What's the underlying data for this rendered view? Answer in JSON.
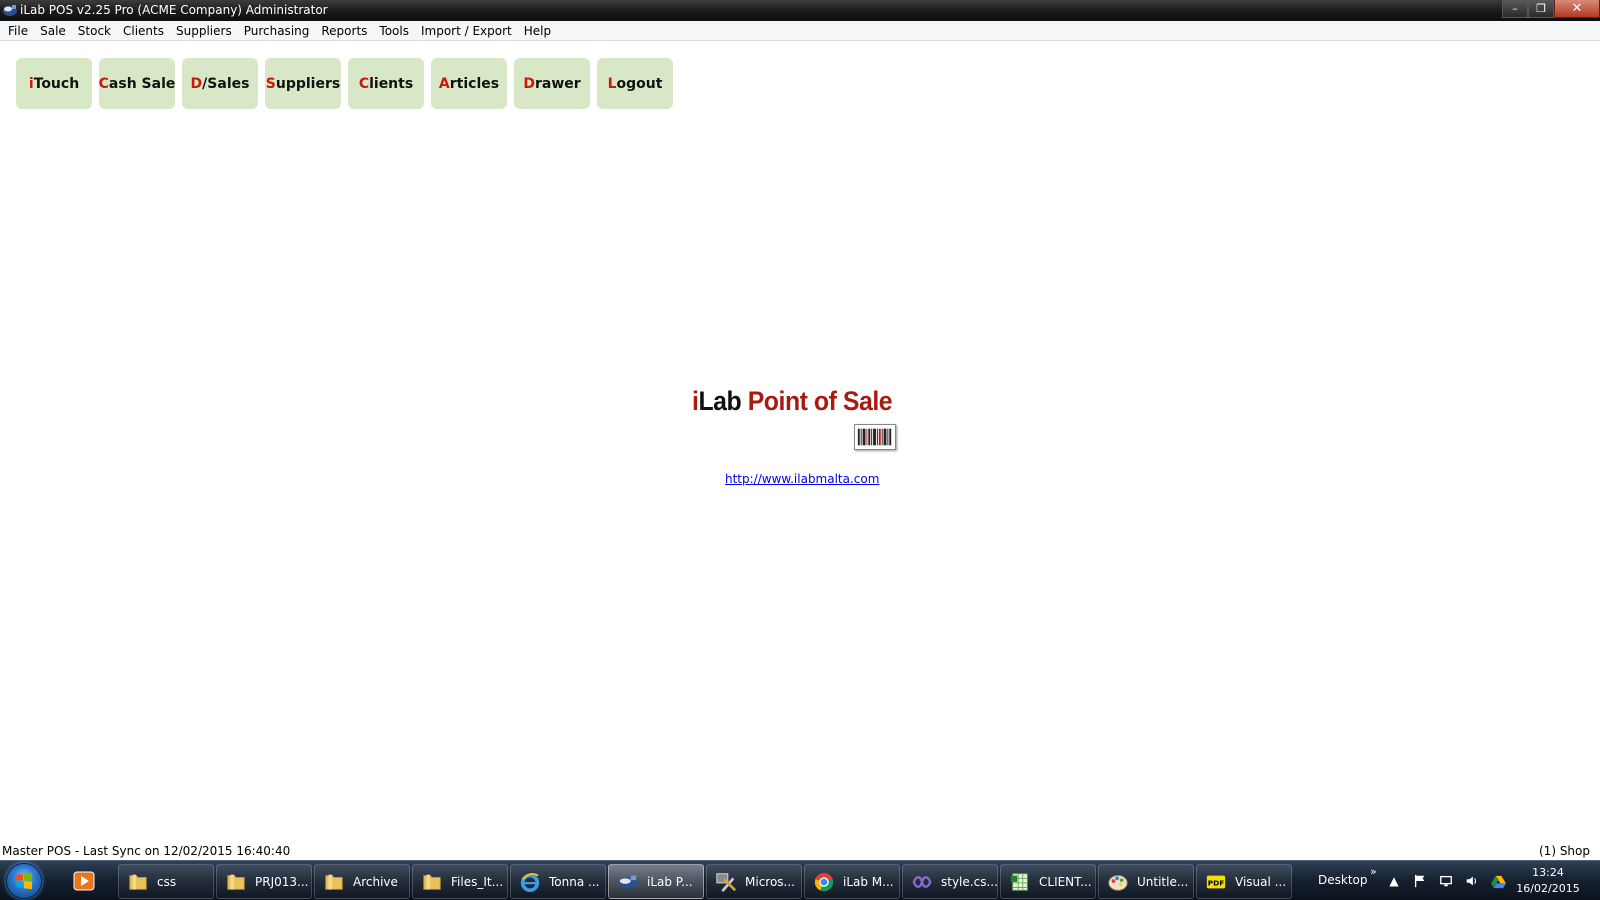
{
  "window": {
    "title": "iLab POS v2.25 Pro (ACME Company) Administrator",
    "controls": {
      "minimize": "–",
      "maximize": "❐",
      "close": "✕"
    }
  },
  "menubar": {
    "items": [
      "File",
      "Sale",
      "Stock",
      "Clients",
      "Suppliers",
      "Purchasing",
      "Reports",
      "Tools",
      "Import / Export",
      "Help"
    ]
  },
  "toolbar": {
    "buttons": [
      {
        "first": "i",
        "rest": "Touch"
      },
      {
        "first": "C",
        "rest": "ash Sale"
      },
      {
        "first": "D",
        "rest": "/Sales"
      },
      {
        "first": "S",
        "rest": "uppliers"
      },
      {
        "first": "C",
        "rest": "lients"
      },
      {
        "first": "A",
        "rest": "rticles"
      },
      {
        "first": "D",
        "rest": "rawer"
      },
      {
        "first": "L",
        "rest": "ogout"
      }
    ]
  },
  "logo": {
    "i": "i",
    "lab": "Lab",
    "pos": "Point of Sale"
  },
  "link": {
    "url_text": "http://www.ilabmalta.com"
  },
  "statusbar": {
    "left": "Master POS - Last Sync on 12/02/2015 16:40:40",
    "right": "(1) Shop"
  },
  "taskbar": {
    "tasks": [
      {
        "label": "css",
        "icon": "folder-icon"
      },
      {
        "label": "PRJ013...",
        "icon": "folder-icon"
      },
      {
        "label": "Archive",
        "icon": "folder-icon"
      },
      {
        "label": "Files_It...",
        "icon": "folder-icon"
      },
      {
        "label": "Tonna ...",
        "icon": "ie-icon"
      },
      {
        "label": "iLab P...",
        "icon": "ilab-icon"
      },
      {
        "label": "Micros...",
        "icon": "tools-icon"
      },
      {
        "label": "iLab M...",
        "icon": "chrome-icon"
      },
      {
        "label": "style.cs...",
        "icon": "vs-icon"
      },
      {
        "label": "CLIENT...",
        "icon": "spreadsheet-icon"
      },
      {
        "label": "Untitle...",
        "icon": "paint-icon"
      },
      {
        "label": "Visual ...",
        "icon": "pdf-icon"
      }
    ],
    "active_index": 5,
    "desktop_label": "Desktop",
    "chevron": "»",
    "clock_time": "13:24",
    "clock_date": "16/02/2015"
  }
}
